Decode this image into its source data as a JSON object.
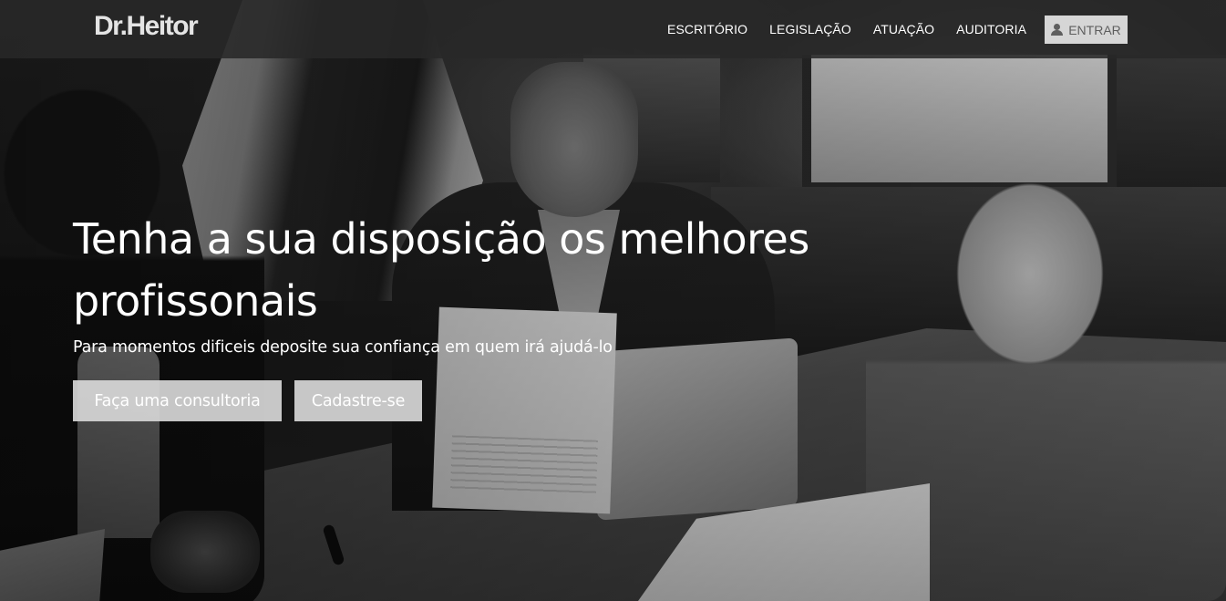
{
  "brand": {
    "logo_text": "Dr.Heitor"
  },
  "nav": {
    "items": [
      {
        "label": "ESCRITÓRIO"
      },
      {
        "label": "LEGISLAÇÃO"
      },
      {
        "label": "ATUAÇÃO"
      },
      {
        "label": "AUDITORIA"
      }
    ],
    "login_label": "ENTRAR",
    "login_icon": "user-icon"
  },
  "hero": {
    "title": "Tenha a sua disposição os melhores profissonais",
    "subtitle": "Para momentos dificeis deposite sua confiança em quem irá ajudá-lo",
    "buttons": {
      "consultoria_label": "Faça uma consultoria",
      "cadastro_label": "Cadastre-se"
    }
  },
  "colors": {
    "navbar_bg": "#282828",
    "button_bg": "#d7d7d7",
    "text": "#ffffff"
  }
}
